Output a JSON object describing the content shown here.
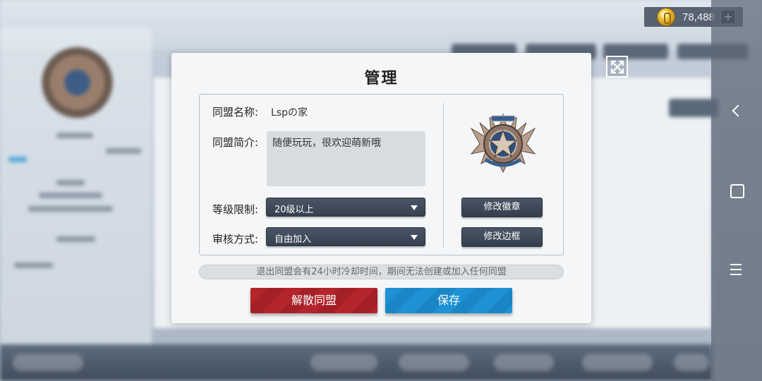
{
  "currency": {
    "amount": "78,488",
    "plus_label": "+"
  },
  "dialog": {
    "title": "管理",
    "name_label": "同盟名称:",
    "name_value": "Lspの家",
    "intro_label": "同盟简介:",
    "intro_value": "随便玩玩，很欢迎萌新哦",
    "level_label": "等级限制:",
    "level_value": "20级以上",
    "review_label": "审核方式:",
    "review_value": "自由加入",
    "change_badge_label": "修改徽章",
    "change_frame_label": "修改边框",
    "notice": "退出同盟会有24小时冷却时间，期间无法创建或加入任何同盟",
    "disband_label": "解散同盟",
    "save_label": "保存"
  },
  "colors": {
    "disband": "#b3242b",
    "save": "#1e92d4",
    "dark_button": "#3f4a5a"
  },
  "icons": [
    "coin-icon",
    "plus-icon",
    "close-icon",
    "back-icon",
    "home-icon",
    "menu-icon",
    "alliance-badge-icon",
    "dropdown-arrow-icon"
  ]
}
